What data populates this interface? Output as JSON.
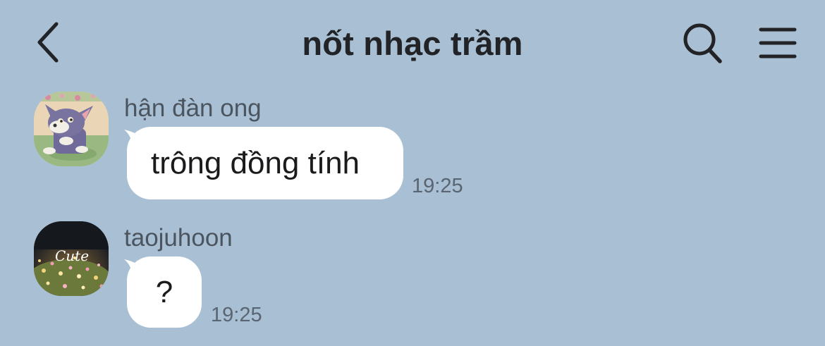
{
  "header": {
    "back_icon": "chevron-left-icon",
    "title": "nốt nhạc trầm",
    "search_icon": "search-icon",
    "menu_icon": "hamburger-menu-icon"
  },
  "messages": [
    {
      "sender": "hận đàn ong",
      "avatar": "cartoon-cat-avatar",
      "text": "trông đồng tính",
      "time": "19:25"
    },
    {
      "sender": "taojuhoon",
      "avatar": "flower-field-avatar",
      "avatar_text": "Cute",
      "text": "?",
      "time": "19:25"
    }
  ],
  "colors": {
    "background": "#a9bfd3",
    "bubble": "#ffffff",
    "title_text": "#222326",
    "sender_text": "#4b5560",
    "time_text": "#5a6573"
  }
}
